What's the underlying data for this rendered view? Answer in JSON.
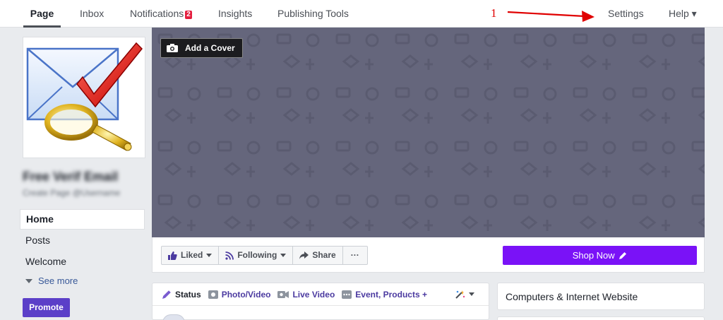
{
  "topnav": {
    "tabs": [
      {
        "label": "Page",
        "active": true
      },
      {
        "label": "Inbox"
      },
      {
        "label": "Notifications",
        "badge": "2"
      },
      {
        "label": "Insights"
      },
      {
        "label": "Publishing Tools"
      }
    ],
    "right": [
      {
        "label": "Settings"
      },
      {
        "label": "Help ▾"
      }
    ],
    "annotation_number": "1",
    "annotation_color": "#e00000"
  },
  "profile": {
    "page_name": "Free Verif Email",
    "page_username": "Create Page @Username"
  },
  "sidebar": {
    "items": [
      {
        "label": "Home",
        "active": true
      },
      {
        "label": "Posts"
      },
      {
        "label": "Welcome"
      }
    ],
    "see_more": "See more",
    "promote": "Promote"
  },
  "cover": {
    "add_cover_label": "Add a Cover",
    "background_color": "#65667c"
  },
  "actions": {
    "liked": "Liked",
    "following": "Following",
    "share": "Share",
    "more": "···",
    "shop_now": "Shop Now",
    "accent": "#7a12f7"
  },
  "composer": {
    "tabs": [
      {
        "label": "Status",
        "icon": "pencil-icon"
      },
      {
        "label": "Photo/Video",
        "icon": "photo-icon"
      },
      {
        "label": "Live Video",
        "icon": "video-camera-icon"
      },
      {
        "label": "Event, Products +",
        "icon": "more-icon"
      }
    ]
  },
  "info": {
    "category": "Computers & Internet Website"
  }
}
